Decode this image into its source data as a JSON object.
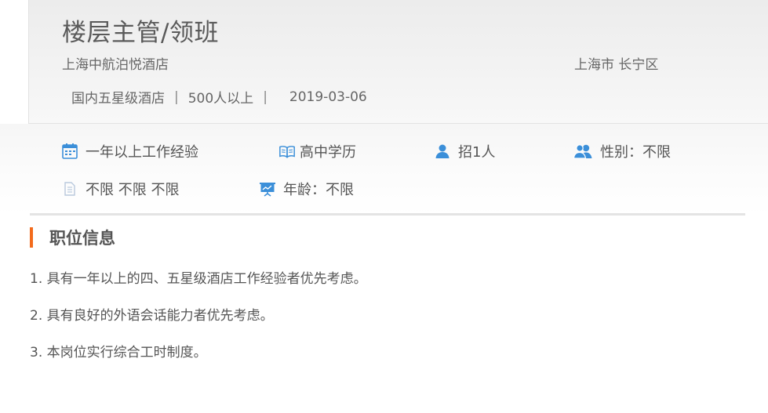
{
  "job": {
    "title": "楼层主管/领班",
    "company": "上海中航泊悦酒店",
    "location": "上海市 长宁区",
    "industry": "国内五星级酒店",
    "separator": "|",
    "size": "500人以上",
    "date": "2019-03-06"
  },
  "attributes": {
    "experience": {
      "icon": "calendar-icon",
      "text": "一年以上工作经验"
    },
    "education": {
      "icon": "open-book-icon",
      "text": "高中学历"
    },
    "headcount": {
      "icon": "person-icon",
      "text": "招1人"
    },
    "gender": {
      "icon": "people-icon",
      "text": "性别：不限"
    },
    "other": {
      "icon": "document-icon",
      "text": "不限 不限 不限"
    },
    "age": {
      "icon": "presentation-board-icon",
      "text": "年龄：不限"
    }
  },
  "section": {
    "title": "职位信息",
    "accent_color": "#f36b1c",
    "lines": [
      "1. 具有一年以上的四、五星级酒店工作经验者优先考虑。",
      "2. 具有良好的外语会话能力者优先考虑。",
      "3. 本岗位实行综合工时制度。"
    ]
  },
  "colors": {
    "icon_blue": "#3b8fd9",
    "icon_light": "#b9c9dd"
  }
}
